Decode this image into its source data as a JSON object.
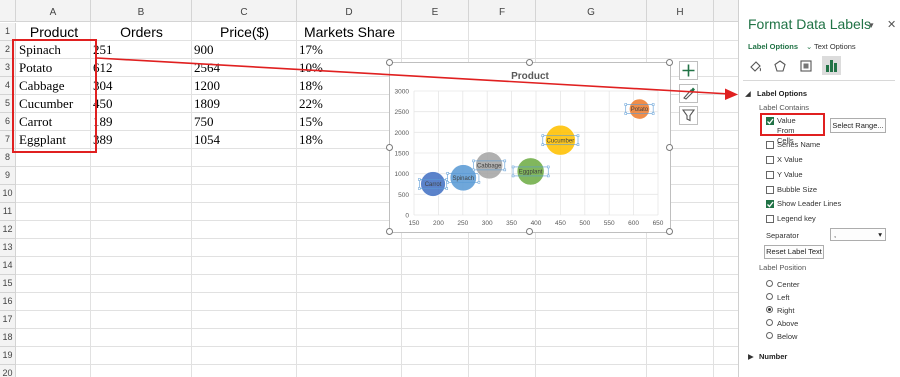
{
  "sheet": {
    "columns": [
      "A",
      "B",
      "C",
      "D",
      "E",
      "F",
      "G",
      "H"
    ],
    "rows": [
      "1",
      "2",
      "3",
      "4",
      "5",
      "6",
      "7",
      "8",
      "9",
      "10",
      "11",
      "12",
      "13",
      "14",
      "15",
      "16",
      "17",
      "18",
      "19",
      "20"
    ],
    "headers": {
      "product": "Product",
      "orders": "Orders",
      "price": "Price($)",
      "share": "Markets Share"
    },
    "data": [
      {
        "product": "Spinach",
        "orders": "251",
        "price": "900",
        "share": "17%"
      },
      {
        "product": "Potato",
        "orders": "612",
        "price": "2564",
        "share": "10%"
      },
      {
        "product": "Cabbage",
        "orders": "304",
        "price": "1200",
        "share": "18%"
      },
      {
        "product": "Cucumber",
        "orders": "450",
        "price": "1809",
        "share": "22%"
      },
      {
        "product": "Carrot",
        "orders": "189",
        "price": "750",
        "share": "15%"
      },
      {
        "product": "Eggplant",
        "orders": "389",
        "price": "1054",
        "share": "18%"
      }
    ]
  },
  "chart_data": {
    "type": "scatter",
    "title": "Product",
    "xlim": [
      150,
      650
    ],
    "ylim": [
      0,
      3000
    ],
    "xticks": [
      "150",
      "200",
      "250",
      "300",
      "350",
      "400",
      "450",
      "500",
      "550",
      "600",
      "650"
    ],
    "yticks": [
      "0",
      "500",
      "1000",
      "1500",
      "2000",
      "2500",
      "3000"
    ],
    "grid": true,
    "points": [
      {
        "label": "Spinach",
        "x": 251,
        "y": 900,
        "size": 17,
        "color": "#5b9bd5"
      },
      {
        "label": "Potato",
        "x": 612,
        "y": 2564,
        "size": 10,
        "color": "#ed7d31"
      },
      {
        "label": "Cabbage",
        "x": 304,
        "y": 1200,
        "size": 18,
        "color": "#a5a5a5"
      },
      {
        "label": "Cucumber",
        "x": 450,
        "y": 1809,
        "size": 22,
        "color": "#ffc000"
      },
      {
        "label": "Carrot",
        "x": 189,
        "y": 750,
        "size": 15,
        "color": "#4472c4"
      },
      {
        "label": "Eggplant",
        "x": 389,
        "y": 1054,
        "size": 18,
        "color": "#70ad47"
      }
    ]
  },
  "pane": {
    "title": "Format Data Labels",
    "tab_label_options": "Label Options",
    "tab_text_options": "Text Options",
    "section_label_options": "Label Options",
    "label_contains": "Label Contains",
    "options": [
      {
        "label": "Value From Cells",
        "checked": true
      },
      {
        "label": "Series Name",
        "checked": false
      },
      {
        "label": "X Value",
        "checked": false
      },
      {
        "label": "Y Value",
        "checked": false
      },
      {
        "label": "Bubble Size",
        "checked": false
      },
      {
        "label": "Show Leader Lines",
        "checked": true
      },
      {
        "label": "Legend key",
        "checked": false
      }
    ],
    "select_range": "Select Range...",
    "separator_label": "Separator",
    "separator_value": ",",
    "reset_label": "Reset Label Text",
    "label_position": "Label Position",
    "positions": [
      {
        "label": "Center",
        "selected": false
      },
      {
        "label": "Left",
        "selected": false
      },
      {
        "label": "Right",
        "selected": true
      },
      {
        "label": "Above",
        "selected": false
      },
      {
        "label": "Below",
        "selected": false
      }
    ],
    "number": "Number",
    "colors": {
      "accent": "#217346",
      "annotation": "#e02020"
    }
  }
}
